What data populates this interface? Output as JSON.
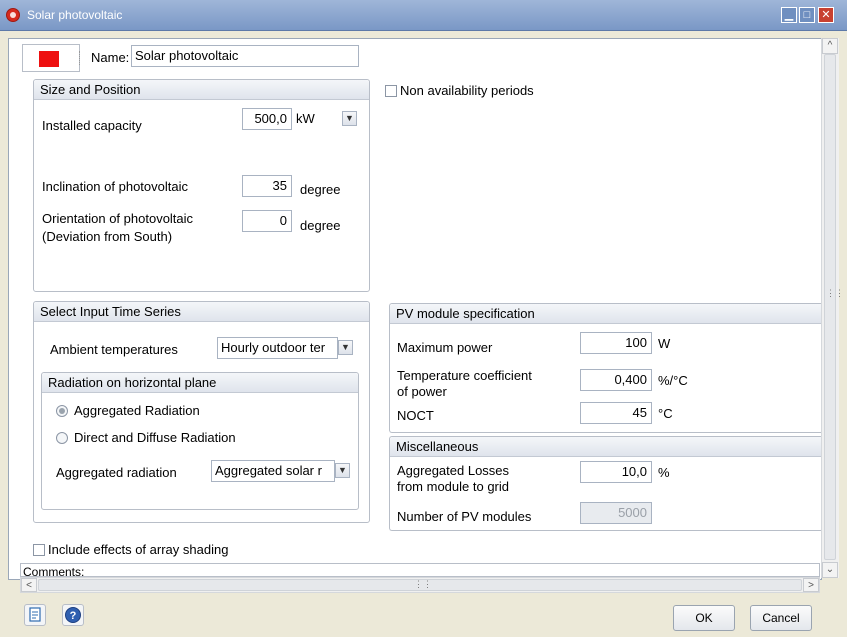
{
  "window": {
    "title": "Solar photovoltaic"
  },
  "header": {
    "color": "#ee1010",
    "name_label": "Name:",
    "name_value": "Solar photovoltaic"
  },
  "non_availability": {
    "label": "Non availability periods",
    "checked": false
  },
  "size_position": {
    "title": "Size and Position",
    "installed_capacity": {
      "label": "Installed capacity",
      "value": "500,0",
      "unit": "kW"
    },
    "inclination": {
      "label": "Inclination of photovoltaic",
      "value": "35",
      "unit": "degree"
    },
    "orientation": {
      "label_line1": "Orientation of photovoltaic",
      "label_line2": "(Deviation from South)",
      "value": "0",
      "unit": "degree"
    }
  },
  "input_series": {
    "title": "Select Input Time Series",
    "ambient": {
      "label": "Ambient temperatures",
      "value": "Hourly outdoor ter"
    },
    "radiation": {
      "title": "Radiation on horizontal plane",
      "option_aggregated": "Aggregated Radiation",
      "option_direct": "Direct and Diffuse Radiation",
      "selected": "aggregated",
      "aggregated_label": "Aggregated radiation",
      "aggregated_value": "Aggregated solar r"
    }
  },
  "pv_spec": {
    "title": "PV module specification",
    "max_power": {
      "label": "Maximum power",
      "value": "100",
      "unit": "W"
    },
    "temp_coeff": {
      "label_line1": "Temperature coefficient",
      "label_line2": "of power",
      "value": "0,400",
      "unit": "%/°C"
    },
    "noct": {
      "label": "NOCT",
      "value": "45",
      "unit": "°C"
    }
  },
  "misc": {
    "title": "Miscellaneous",
    "losses": {
      "label_line1": "Aggregated Losses",
      "label_line2": "from module to grid",
      "value": "10,0",
      "unit": "%"
    },
    "modules": {
      "label": "Number of PV modules",
      "value": "5000"
    }
  },
  "shading": {
    "label": "Include effects of array shading",
    "checked": false
  },
  "comments": {
    "label": "Comments:"
  },
  "footer": {
    "ok_label": "OK",
    "cancel_label": "Cancel"
  },
  "icons": {
    "notes": "notes-icon",
    "help": "help-icon",
    "app": "app-logo-icon"
  }
}
